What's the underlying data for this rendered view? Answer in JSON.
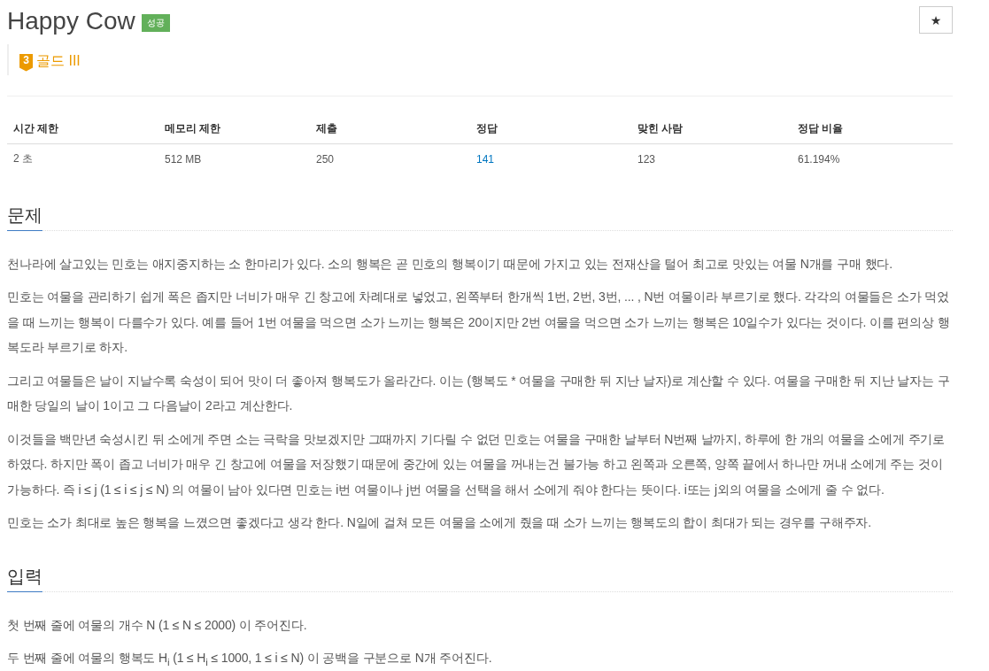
{
  "header": {
    "title": "Happy Cow",
    "result_badge": {
      "kind": "success",
      "text": "성공"
    },
    "star_button": "★"
  },
  "tier": {
    "level": "3",
    "label": "골드 III"
  },
  "stats_table": {
    "columns": [
      "시간 제한",
      "메모리 제한",
      "제출",
      "정답",
      "맞힌 사람",
      "정답 비율"
    ],
    "rows": [
      {
        "cells": [
          {
            "kind": "text",
            "text": "2 초"
          },
          {
            "kind": "text",
            "text": "512 MB"
          },
          {
            "kind": "text",
            "text": "250"
          },
          {
            "kind": "link",
            "text": "141"
          },
          {
            "kind": "text",
            "text": "123"
          },
          {
            "kind": "text",
            "text": "61.194%"
          }
        ]
      }
    ]
  },
  "sections": [
    {
      "heading": "문제",
      "paragraphs": [
        "천나라에 살고있는 민호는 애지중지하는 소 한마리가 있다. 소의 행복은 곧 민호의 행복이기 때문에 가지고 있는 전재산을 털어 최고로 맛있는 여물 N개를 구매 했다.",
        "민호는 여물을 관리하기 쉽게 폭은 좁지만 너비가 매우 긴 창고에 차례대로 넣었고, 왼쪽부터 한개씩 1번, 2번, 3번, ... , N번 여물이라 부르기로 했다. 각각의 여물들은 소가 먹었을 때 느끼는 행복이 다를수가 있다. 예를 들어 1번 여물을 먹으면 소가 느끼는 행복은 20이지만 2번 여물을 먹으면 소가 느끼는 행복은 10일수가 있다는 것이다. 이를 편의상 행복도라 부르기로 하자.",
        "그리고 여물들은 날이 지날수록 숙성이 되어 맛이 더 좋아져 행복도가 올라간다. 이는 (행복도 * 여물을 구매한 뒤 지난 날자)로 계산할 수 있다. 여물을 구매한 뒤 지난 날자는 구매한 당일의 날이 1이고 그 다음날이 2라고 계산한다.",
        "이것들을 백만년 숙성시킨 뒤 소에게 주면 소는 극락을 맛보겠지만 그때까지 기다릴 수 없던 민호는 여물을 구매한 날부터 N번째 날까지, 하루에 한 개의 여물을 소에게 주기로 하였다. 하지만 폭이 좁고 너비가 매우 긴 창고에 여물을 저장했기 때문에 중간에 있는 여물을 꺼내는건 불가능 하고 왼쪽과 오른쪽, 양쪽 끝에서 하나만 꺼내 소에게 주는 것이 가능하다. 즉 i ≤ j (1 ≤ i ≤ j ≤ N) 의 여물이 남아 있다면 민호는 i번 여물이나 j번 여물을 선택을 해서 소에게 줘야 한다는 뜻이다. i또는 j외의 여물을 소에게 줄 수 없다.",
        "민호는 소가 최대로 높은 행복을 느꼈으면 좋겠다고 생각 한다. N일에 걸쳐 모든 여물을 소에게 줬을 때 소가 느끼는 행복도의 합이 최대가 되는 경우를 구해주자."
      ]
    },
    {
      "heading": "입력",
      "paragraphs": [
        "첫 번째 줄에 여물의 개수 N (1 ≤ N ≤ 2000) 이 주어진다.",
        "두 번째 줄에 여물의 행복도 H$_{i}$ (1 ≤ H$_{i}$ ≤ 1000, 1 ≤ i ≤ N) 이 공백을 구분으로 N개 주어진다."
      ]
    }
  ]
}
